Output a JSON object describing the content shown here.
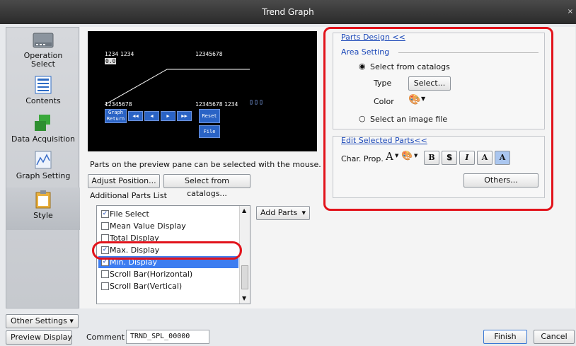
{
  "window": {
    "title": "Trend Graph",
    "close_glyph": "×"
  },
  "sidebar": {
    "items": [
      {
        "label": "Operation\nSelect",
        "icon": "folder-icon"
      },
      {
        "label": "Contents",
        "icon": "document-list-icon"
      },
      {
        "label": "Data Acquisition",
        "icon": "green-blocks-icon"
      },
      {
        "label": "Graph Setting",
        "icon": "line-graph-icon"
      },
      {
        "label": "Style",
        "icon": "clipboard-icon"
      }
    ],
    "other_settings_label": "Other Settings"
  },
  "preview": {
    "top_left_a": "1234",
    "top_left_b": "1234",
    "top_right": "12345678",
    "bottom_left": "12345678",
    "bottom_right": "12345678",
    "bottom_right_suffix": "1234",
    "side_value": "0.0",
    "buttons": {
      "graph_return": "Graph\nReturn",
      "rewind_fast": "◀◀",
      "rewind": "◀",
      "forward": "▶",
      "forward_fast": "▶▶",
      "reset": "Reset",
      "file": "File"
    },
    "hint": "Parts on the preview pane can be selected with the mouse."
  },
  "actions": {
    "adjust_position": "Adjust Position...",
    "select_from_catalogs": "Select from catalogs..."
  },
  "additional_parts": {
    "label": "Additional Parts List",
    "add_parts_label": "Add Parts",
    "items": [
      {
        "label": "File Select",
        "checked": true
      },
      {
        "label": "Mean Value Display",
        "checked": false
      },
      {
        "label": "Total Display",
        "checked": false
      },
      {
        "label": "Max. Display",
        "checked": true
      },
      {
        "label": "Min. Display",
        "checked": true,
        "selected": true
      },
      {
        "label": "Scroll Bar(Horizontal)",
        "checked": false
      },
      {
        "label": "Scroll Bar(Vertical)",
        "checked": false
      }
    ]
  },
  "parts_design": {
    "header": "Parts Design <<",
    "area_setting": "Area Setting",
    "radio_catalogs": "Select from catalogs",
    "type_label": "Type",
    "select_button": "Select...",
    "color_label": "Color",
    "radio_image": "Select an image file"
  },
  "edit_parts": {
    "header": "Edit Selected Parts<<",
    "char_prop_label": "Char. Prop.",
    "format_buttons": [
      "B",
      "S",
      "I",
      "A",
      "A"
    ],
    "others_button": "Others..."
  },
  "footer": {
    "preview_display": "Preview Display",
    "comment_label": "Comment",
    "comment_value": "TRND_SPL_00000",
    "finish": "Finish",
    "cancel": "Cancel"
  },
  "colors": {
    "highlight_red": "#e2131b",
    "link_blue": "#1a47b8",
    "selection_blue": "#3d7df0",
    "preview_button_blue": "#2a63c5"
  }
}
